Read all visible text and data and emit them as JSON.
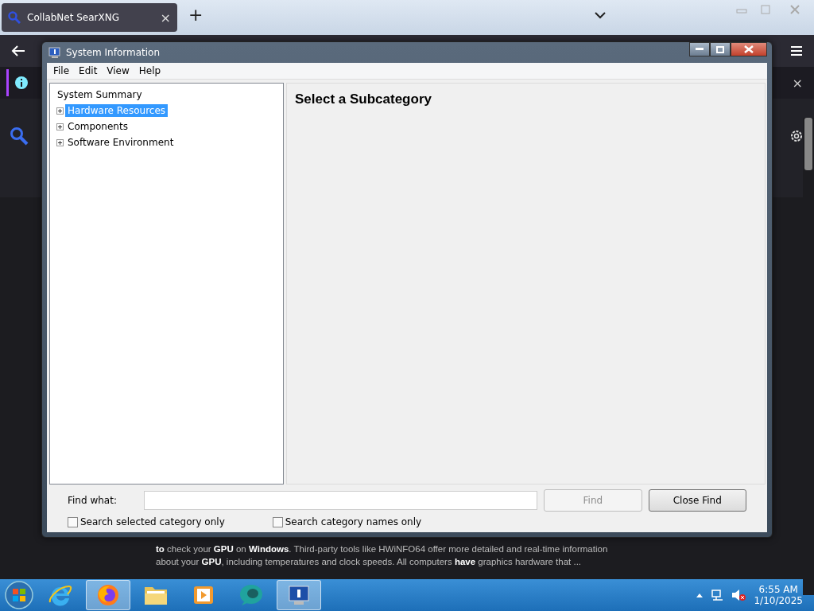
{
  "browser": {
    "tab": {
      "title": "CollabNet SearXNG",
      "close": "×",
      "selected": true
    },
    "new_tab": "+",
    "result_text": "**to** check your **GPU** on **Windows**. Third-party tools like HWiNFO64 offer more detailed and real-time information about your **GPU**, including temperatures and clock speeds. All computers **have** graphics hardware that ...",
    "info_close": "×"
  },
  "window": {
    "title": "System Information",
    "menu": [
      "File",
      "Edit",
      "View",
      "Help"
    ],
    "tree": [
      {
        "label": "System Summary",
        "selected": false,
        "expanded": true,
        "children": [
          {
            "label": "Hardware Resources",
            "selected": true,
            "expanded": false
          },
          {
            "label": "Components",
            "selected": false,
            "expanded": false
          },
          {
            "label": "Software Environment",
            "selected": false,
            "expanded": false
          }
        ]
      }
    ],
    "heading": "Select a Subcategory",
    "find": {
      "label": "Find what:",
      "buttons": [
        {
          "label": "Find",
          "disabled": true
        },
        {
          "label": "Close Find",
          "disabled": false
        }
      ],
      "options": [
        {
          "label": "Search selected category only",
          "checked": false
        },
        {
          "label": "Search category names only",
          "checked": false
        }
      ]
    }
  },
  "taskbar": {
    "apps": [
      {
        "kind": "ie",
        "selected": false
      },
      {
        "kind": "firefox",
        "selected": true
      },
      {
        "kind": "folder",
        "selected": false
      },
      {
        "kind": "media",
        "selected": false
      },
      {
        "kind": "bubble",
        "selected": false
      },
      {
        "kind": "sysinfo",
        "selected": true
      }
    ],
    "time": "6:55 AM",
    "date": "1/10/2025"
  }
}
